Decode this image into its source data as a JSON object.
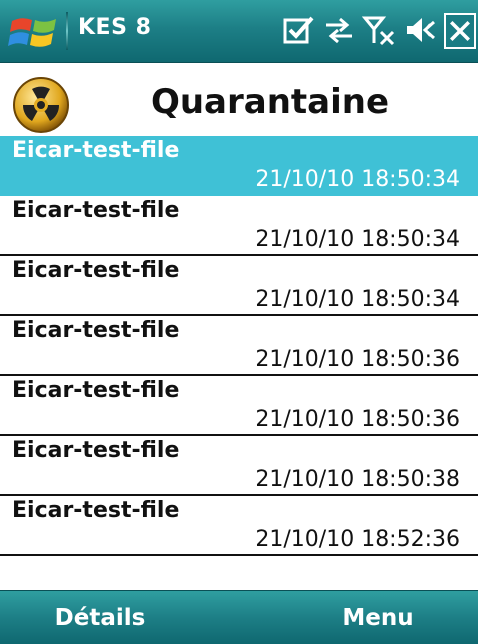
{
  "statusbar": {
    "app_title": "KES 8",
    "icons": [
      "windows-start-icon",
      "notification-check-icon",
      "sync-arrows-icon",
      "signal-off-icon",
      "volume-off-icon",
      "close-icon"
    ]
  },
  "header": {
    "title": "Quarantaine",
    "logo_icon": "radiation-icon"
  },
  "list": {
    "items": [
      {
        "name": "Eicar-test-file",
        "date": "21/10/10 18:50:34",
        "selected": true
      },
      {
        "name": "Eicar-test-file",
        "date": "21/10/10 18:50:34",
        "selected": false
      },
      {
        "name": "Eicar-test-file",
        "date": "21/10/10 18:50:34",
        "selected": false
      },
      {
        "name": "Eicar-test-file",
        "date": "21/10/10 18:50:36",
        "selected": false
      },
      {
        "name": "Eicar-test-file",
        "date": "21/10/10 18:50:36",
        "selected": false
      },
      {
        "name": "Eicar-test-file",
        "date": "21/10/10 18:50:38",
        "selected": false
      },
      {
        "name": "Eicar-test-file",
        "date": "21/10/10 18:52:36",
        "selected": false
      }
    ]
  },
  "softkeys": {
    "left": "Détails",
    "right": "Menu"
  },
  "colors": {
    "bar": "#1d7f86",
    "selection": "#3fc1d6"
  }
}
